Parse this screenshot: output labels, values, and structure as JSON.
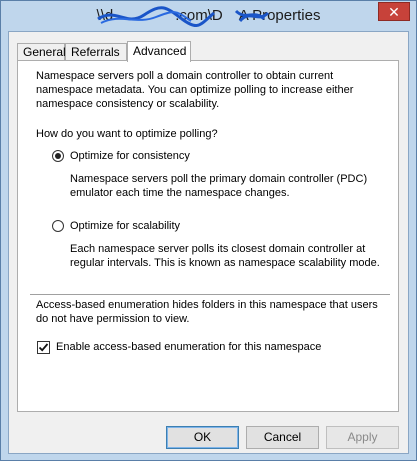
{
  "window": {
    "title_prefix": "\\\\",
    "title_redacted_1": "d",
    "title_mid": ".com\\D",
    "title_redacted_2": "",
    "title_suffix": "A Properties",
    "close_label": "✕"
  },
  "tabs": [
    {
      "label": "General",
      "active": false
    },
    {
      "label": "Referrals",
      "active": false
    },
    {
      "label": "Advanced",
      "active": true
    }
  ],
  "advanced": {
    "intro": "Namespace servers poll a domain controller to obtain current namespace metadata. You can optimize polling to increase either namespace consistency or scalability.",
    "question": "How do you want to optimize polling?",
    "option_consistency": {
      "label": "Optimize for consistency",
      "selected": true,
      "description": "Namespace servers poll the primary domain controller (PDC) emulator each time the namespace changes."
    },
    "option_scalability": {
      "label": "Optimize for scalability",
      "selected": false,
      "description": "Each namespace server polls its closest domain controller at regular intervals. This is known as namespace scalability mode."
    },
    "abe_description": "Access-based enumeration hides folders in this namespace that users do not have permission to view.",
    "abe_checkbox": {
      "label": "Enable access-based enumeration for this namespace",
      "checked": true
    }
  },
  "buttons": {
    "ok": "OK",
    "cancel": "Cancel",
    "apply": "Apply"
  },
  "colors": {
    "window_frame": "#bfd6ec",
    "close_button": "#c7423a",
    "redaction_scribble": "#1a55c8"
  }
}
